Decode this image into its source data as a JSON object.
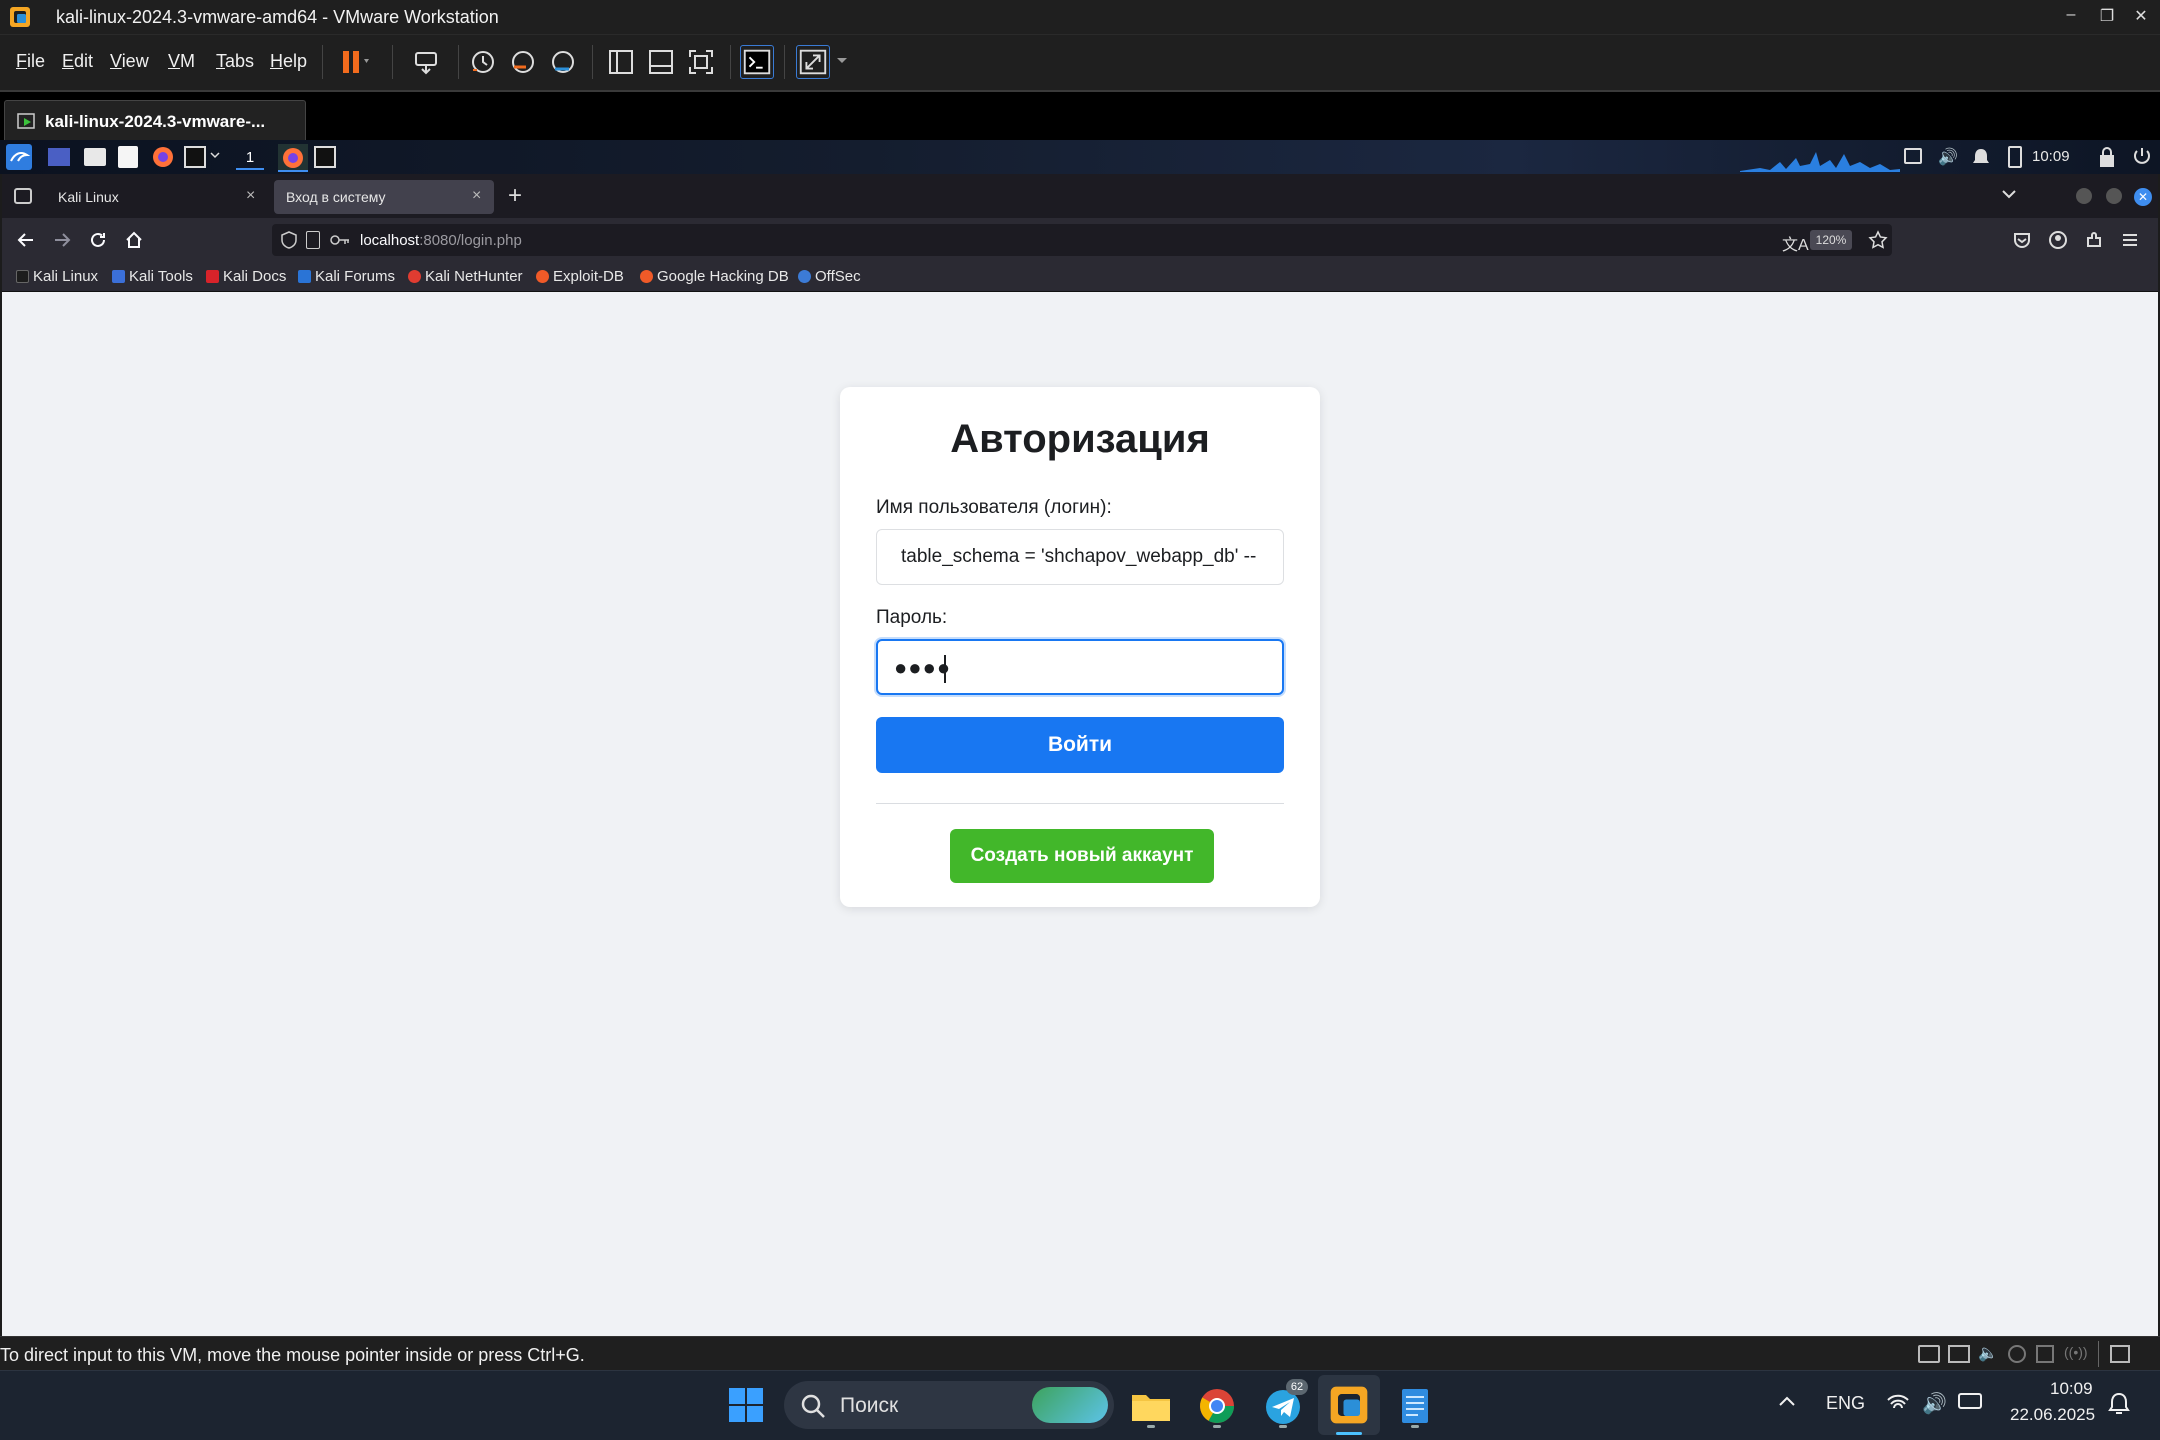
{
  "vmware": {
    "window_title": "kali-linux-2024.3-vmware-amd64 - VMware Workstation",
    "menu": [
      "File",
      "Edit",
      "View",
      "VM",
      "Tabs",
      "Help"
    ],
    "vm_tab_label": "kali-linux-2024.3-vmware-...",
    "status_message": "To direct input to this VM, move the mouse pointer inside or press Ctrl+G."
  },
  "kali_panel": {
    "workspace_number": "1",
    "clock": "10:09"
  },
  "firefox": {
    "tabs": [
      {
        "label": "Kali Linux",
        "active": false
      },
      {
        "label": "Вход в систему",
        "active": true
      }
    ],
    "url_host": "localhost",
    "url_path": ":8080/login.php",
    "zoom": "120%",
    "bookmarks": [
      {
        "label": "Kali Linux",
        "color": "#1d1d1d"
      },
      {
        "label": "Kali Tools",
        "color": "#3b6fd8"
      },
      {
        "label": "Kali Docs",
        "color": "#d8232a"
      },
      {
        "label": "Kali Forums",
        "color": "#2a74d6"
      },
      {
        "label": "Kali NetHunter",
        "color": "#e03c31"
      },
      {
        "label": "Exploit-DB",
        "color": "#f05a28"
      },
      {
        "label": "Google Hacking DB",
        "color": "#f05a28"
      },
      {
        "label": "OffSec",
        "color": "#3c7bd6"
      }
    ]
  },
  "login_page": {
    "heading": "Авторизация",
    "username_label": "Имя пользователя (логин):",
    "username_value": "table_schema = 'shchapov_webapp_db' --",
    "password_label": "Пароль:",
    "password_masked": "●●●●",
    "login_button": "Войти",
    "register_button": "Создать новый аккаунт",
    "colors": {
      "primary": "#1877f2",
      "success": "#42b72a",
      "background": "#f0f2f5"
    }
  },
  "windows_taskbar": {
    "search_placeholder": "Поиск",
    "telegram_badge": "62",
    "language": "ENG",
    "time": "10:09",
    "date": "22.06.2025"
  }
}
